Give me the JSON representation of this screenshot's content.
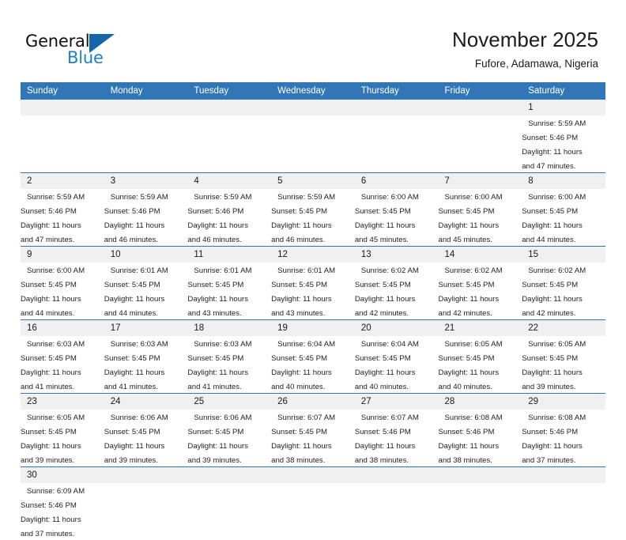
{
  "brand": {
    "name_part1": "General",
    "name_part2": "Blue",
    "flag_icon": "triangle-flag-icon"
  },
  "header": {
    "title": "November 2025",
    "location": "Fufore, Adamawa, Nigeria"
  },
  "calendar": {
    "columns": [
      "Sunday",
      "Monday",
      "Tuesday",
      "Wednesday",
      "Thursday",
      "Friday",
      "Saturday"
    ],
    "accent_color": "#3177b8",
    "daynum_band_color": "#f0f0f0",
    "weeks": [
      [
        {
          "day": "",
          "info": ""
        },
        {
          "day": "",
          "info": ""
        },
        {
          "day": "",
          "info": ""
        },
        {
          "day": "",
          "info": ""
        },
        {
          "day": "",
          "info": ""
        },
        {
          "day": "",
          "info": ""
        },
        {
          "day": "1",
          "info": "Sunrise: 5:59 AM\nSunset: 5:46 PM\nDaylight: 11 hours\nand 47 minutes."
        }
      ],
      [
        {
          "day": "2",
          "info": "Sunrise: 5:59 AM\nSunset: 5:46 PM\nDaylight: 11 hours\nand 47 minutes."
        },
        {
          "day": "3",
          "info": "Sunrise: 5:59 AM\nSunset: 5:46 PM\nDaylight: 11 hours\nand 46 minutes."
        },
        {
          "day": "4",
          "info": "Sunrise: 5:59 AM\nSunset: 5:46 PM\nDaylight: 11 hours\nand 46 minutes."
        },
        {
          "day": "5",
          "info": "Sunrise: 5:59 AM\nSunset: 5:45 PM\nDaylight: 11 hours\nand 46 minutes."
        },
        {
          "day": "6",
          "info": "Sunrise: 6:00 AM\nSunset: 5:45 PM\nDaylight: 11 hours\nand 45 minutes."
        },
        {
          "day": "7",
          "info": "Sunrise: 6:00 AM\nSunset: 5:45 PM\nDaylight: 11 hours\nand 45 minutes."
        },
        {
          "day": "8",
          "info": "Sunrise: 6:00 AM\nSunset: 5:45 PM\nDaylight: 11 hours\nand 44 minutes."
        }
      ],
      [
        {
          "day": "9",
          "info": "Sunrise: 6:00 AM\nSunset: 5:45 PM\nDaylight: 11 hours\nand 44 minutes."
        },
        {
          "day": "10",
          "info": "Sunrise: 6:01 AM\nSunset: 5:45 PM\nDaylight: 11 hours\nand 44 minutes."
        },
        {
          "day": "11",
          "info": "Sunrise: 6:01 AM\nSunset: 5:45 PM\nDaylight: 11 hours\nand 43 minutes."
        },
        {
          "day": "12",
          "info": "Sunrise: 6:01 AM\nSunset: 5:45 PM\nDaylight: 11 hours\nand 43 minutes."
        },
        {
          "day": "13",
          "info": "Sunrise: 6:02 AM\nSunset: 5:45 PM\nDaylight: 11 hours\nand 42 minutes."
        },
        {
          "day": "14",
          "info": "Sunrise: 6:02 AM\nSunset: 5:45 PM\nDaylight: 11 hours\nand 42 minutes."
        },
        {
          "day": "15",
          "info": "Sunrise: 6:02 AM\nSunset: 5:45 PM\nDaylight: 11 hours\nand 42 minutes."
        }
      ],
      [
        {
          "day": "16",
          "info": "Sunrise: 6:03 AM\nSunset: 5:45 PM\nDaylight: 11 hours\nand 41 minutes."
        },
        {
          "day": "17",
          "info": "Sunrise: 6:03 AM\nSunset: 5:45 PM\nDaylight: 11 hours\nand 41 minutes."
        },
        {
          "day": "18",
          "info": "Sunrise: 6:03 AM\nSunset: 5:45 PM\nDaylight: 11 hours\nand 41 minutes."
        },
        {
          "day": "19",
          "info": "Sunrise: 6:04 AM\nSunset: 5:45 PM\nDaylight: 11 hours\nand 40 minutes."
        },
        {
          "day": "20",
          "info": "Sunrise: 6:04 AM\nSunset: 5:45 PM\nDaylight: 11 hours\nand 40 minutes."
        },
        {
          "day": "21",
          "info": "Sunrise: 6:05 AM\nSunset: 5:45 PM\nDaylight: 11 hours\nand 40 minutes."
        },
        {
          "day": "22",
          "info": "Sunrise: 6:05 AM\nSunset: 5:45 PM\nDaylight: 11 hours\nand 39 minutes."
        }
      ],
      [
        {
          "day": "23",
          "info": "Sunrise: 6:05 AM\nSunset: 5:45 PM\nDaylight: 11 hours\nand 39 minutes."
        },
        {
          "day": "24",
          "info": "Sunrise: 6:06 AM\nSunset: 5:45 PM\nDaylight: 11 hours\nand 39 minutes."
        },
        {
          "day": "25",
          "info": "Sunrise: 6:06 AM\nSunset: 5:45 PM\nDaylight: 11 hours\nand 39 minutes."
        },
        {
          "day": "26",
          "info": "Sunrise: 6:07 AM\nSunset: 5:45 PM\nDaylight: 11 hours\nand 38 minutes."
        },
        {
          "day": "27",
          "info": "Sunrise: 6:07 AM\nSunset: 5:46 PM\nDaylight: 11 hours\nand 38 minutes."
        },
        {
          "day": "28",
          "info": "Sunrise: 6:08 AM\nSunset: 5:46 PM\nDaylight: 11 hours\nand 38 minutes."
        },
        {
          "day": "29",
          "info": "Sunrise: 6:08 AM\nSunset: 5:46 PM\nDaylight: 11 hours\nand 37 minutes."
        }
      ],
      [
        {
          "day": "30",
          "info": "Sunrise: 6:09 AM\nSunset: 5:46 PM\nDaylight: 11 hours\nand 37 minutes."
        },
        {
          "day": "",
          "info": ""
        },
        {
          "day": "",
          "info": ""
        },
        {
          "day": "",
          "info": ""
        },
        {
          "day": "",
          "info": ""
        },
        {
          "day": "",
          "info": ""
        },
        {
          "day": "",
          "info": ""
        }
      ]
    ]
  }
}
